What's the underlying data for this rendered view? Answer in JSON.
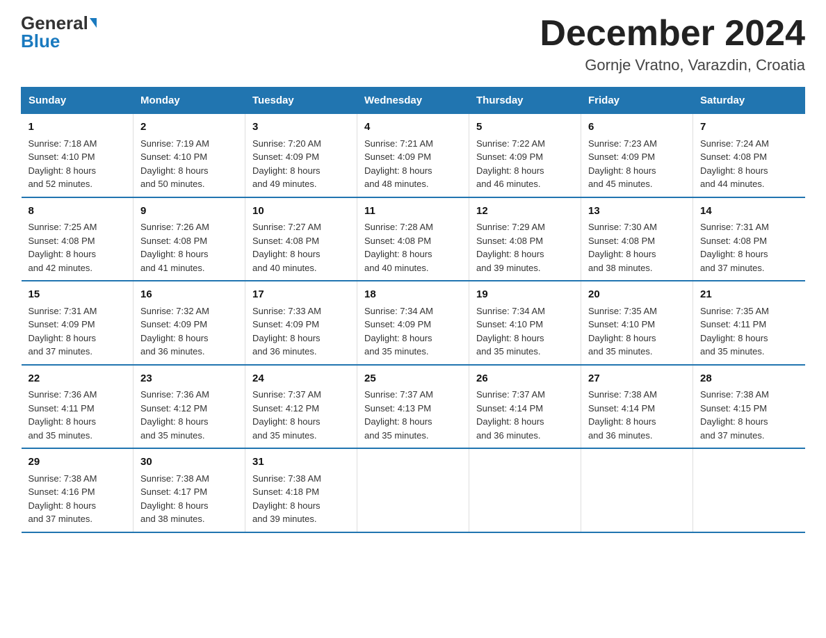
{
  "header": {
    "logo_general": "General",
    "logo_blue": "Blue",
    "title": "December 2024",
    "subtitle": "Gornje Vratno, Varazdin, Croatia"
  },
  "days_of_week": [
    "Sunday",
    "Monday",
    "Tuesday",
    "Wednesday",
    "Thursday",
    "Friday",
    "Saturday"
  ],
  "weeks": [
    [
      {
        "day": "1",
        "sunrise": "7:18 AM",
        "sunset": "4:10 PM",
        "daylight": "8 hours and 52 minutes."
      },
      {
        "day": "2",
        "sunrise": "7:19 AM",
        "sunset": "4:10 PM",
        "daylight": "8 hours and 50 minutes."
      },
      {
        "day": "3",
        "sunrise": "7:20 AM",
        "sunset": "4:09 PM",
        "daylight": "8 hours and 49 minutes."
      },
      {
        "day": "4",
        "sunrise": "7:21 AM",
        "sunset": "4:09 PM",
        "daylight": "8 hours and 48 minutes."
      },
      {
        "day": "5",
        "sunrise": "7:22 AM",
        "sunset": "4:09 PM",
        "daylight": "8 hours and 46 minutes."
      },
      {
        "day": "6",
        "sunrise": "7:23 AM",
        "sunset": "4:09 PM",
        "daylight": "8 hours and 45 minutes."
      },
      {
        "day": "7",
        "sunrise": "7:24 AM",
        "sunset": "4:08 PM",
        "daylight": "8 hours and 44 minutes."
      }
    ],
    [
      {
        "day": "8",
        "sunrise": "7:25 AM",
        "sunset": "4:08 PM",
        "daylight": "8 hours and 42 minutes."
      },
      {
        "day": "9",
        "sunrise": "7:26 AM",
        "sunset": "4:08 PM",
        "daylight": "8 hours and 41 minutes."
      },
      {
        "day": "10",
        "sunrise": "7:27 AM",
        "sunset": "4:08 PM",
        "daylight": "8 hours and 40 minutes."
      },
      {
        "day": "11",
        "sunrise": "7:28 AM",
        "sunset": "4:08 PM",
        "daylight": "8 hours and 40 minutes."
      },
      {
        "day": "12",
        "sunrise": "7:29 AM",
        "sunset": "4:08 PM",
        "daylight": "8 hours and 39 minutes."
      },
      {
        "day": "13",
        "sunrise": "7:30 AM",
        "sunset": "4:08 PM",
        "daylight": "8 hours and 38 minutes."
      },
      {
        "day": "14",
        "sunrise": "7:31 AM",
        "sunset": "4:08 PM",
        "daylight": "8 hours and 37 minutes."
      }
    ],
    [
      {
        "day": "15",
        "sunrise": "7:31 AM",
        "sunset": "4:09 PM",
        "daylight": "8 hours and 37 minutes."
      },
      {
        "day": "16",
        "sunrise": "7:32 AM",
        "sunset": "4:09 PM",
        "daylight": "8 hours and 36 minutes."
      },
      {
        "day": "17",
        "sunrise": "7:33 AM",
        "sunset": "4:09 PM",
        "daylight": "8 hours and 36 minutes."
      },
      {
        "day": "18",
        "sunrise": "7:34 AM",
        "sunset": "4:09 PM",
        "daylight": "8 hours and 35 minutes."
      },
      {
        "day": "19",
        "sunrise": "7:34 AM",
        "sunset": "4:10 PM",
        "daylight": "8 hours and 35 minutes."
      },
      {
        "day": "20",
        "sunrise": "7:35 AM",
        "sunset": "4:10 PM",
        "daylight": "8 hours and 35 minutes."
      },
      {
        "day": "21",
        "sunrise": "7:35 AM",
        "sunset": "4:11 PM",
        "daylight": "8 hours and 35 minutes."
      }
    ],
    [
      {
        "day": "22",
        "sunrise": "7:36 AM",
        "sunset": "4:11 PM",
        "daylight": "8 hours and 35 minutes."
      },
      {
        "day": "23",
        "sunrise": "7:36 AM",
        "sunset": "4:12 PM",
        "daylight": "8 hours and 35 minutes."
      },
      {
        "day": "24",
        "sunrise": "7:37 AM",
        "sunset": "4:12 PM",
        "daylight": "8 hours and 35 minutes."
      },
      {
        "day": "25",
        "sunrise": "7:37 AM",
        "sunset": "4:13 PM",
        "daylight": "8 hours and 35 minutes."
      },
      {
        "day": "26",
        "sunrise": "7:37 AM",
        "sunset": "4:14 PM",
        "daylight": "8 hours and 36 minutes."
      },
      {
        "day": "27",
        "sunrise": "7:38 AM",
        "sunset": "4:14 PM",
        "daylight": "8 hours and 36 minutes."
      },
      {
        "day": "28",
        "sunrise": "7:38 AM",
        "sunset": "4:15 PM",
        "daylight": "8 hours and 37 minutes."
      }
    ],
    [
      {
        "day": "29",
        "sunrise": "7:38 AM",
        "sunset": "4:16 PM",
        "daylight": "8 hours and 37 minutes."
      },
      {
        "day": "30",
        "sunrise": "7:38 AM",
        "sunset": "4:17 PM",
        "daylight": "8 hours and 38 minutes."
      },
      {
        "day": "31",
        "sunrise": "7:38 AM",
        "sunset": "4:18 PM",
        "daylight": "8 hours and 39 minutes."
      },
      {
        "day": "",
        "sunrise": "",
        "sunset": "",
        "daylight": ""
      },
      {
        "day": "",
        "sunrise": "",
        "sunset": "",
        "daylight": ""
      },
      {
        "day": "",
        "sunrise": "",
        "sunset": "",
        "daylight": ""
      },
      {
        "day": "",
        "sunrise": "",
        "sunset": "",
        "daylight": ""
      }
    ]
  ],
  "labels": {
    "sunrise_prefix": "Sunrise: ",
    "sunset_prefix": "Sunset: ",
    "daylight_prefix": "Daylight: "
  }
}
